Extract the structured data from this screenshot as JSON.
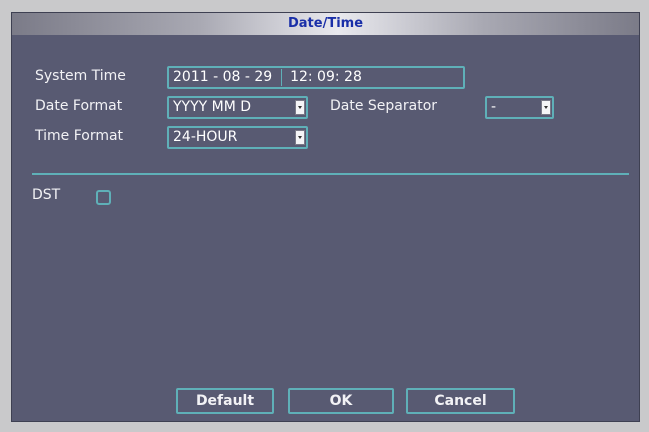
{
  "window": {
    "title": "Date/Time"
  },
  "system_time": {
    "label": "System Time",
    "date": "2011 - 08 - 29",
    "time": "12: 09: 28"
  },
  "date_format": {
    "label": "Date Format",
    "value": "YYYY MM D"
  },
  "date_separator": {
    "label": "Date Separator",
    "value": "-"
  },
  "time_format": {
    "label": "Time Format",
    "value": "24-HOUR"
  },
  "dst": {
    "label": "DST",
    "checked": false
  },
  "buttons": {
    "default": "Default",
    "ok": "OK",
    "cancel": "Cancel"
  },
  "colors": {
    "accent": "#5fb0b8",
    "panel": "#585a72",
    "title_text": "#1a2fa8"
  }
}
